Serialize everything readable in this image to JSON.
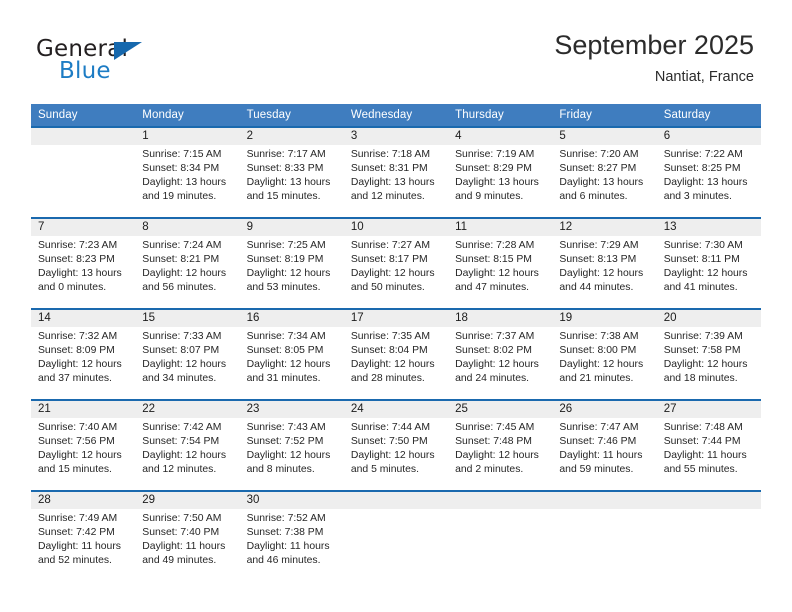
{
  "brand": {
    "word_one": "General",
    "word_two": "Blue",
    "logo_icon": "triangle-logo-icon",
    "accent_color": "#1d7cc4"
  },
  "header": {
    "title": "September 2025",
    "subtitle": "Nantiat, France"
  },
  "theme": {
    "header_row_color": "#3f7dbf",
    "week_divider_color": "#1a69ae",
    "daynum_band_color": "#eeeeee"
  },
  "calendar": {
    "day_headers": [
      "Sunday",
      "Monday",
      "Tuesday",
      "Wednesday",
      "Thursday",
      "Friday",
      "Saturday"
    ],
    "weeks": [
      [
        {
          "day": "",
          "empty": true
        },
        {
          "day": "1",
          "sunrise": "Sunrise: 7:15 AM",
          "sunset": "Sunset: 8:34 PM",
          "daylight_1": "Daylight: 13 hours",
          "daylight_2": "and 19 minutes."
        },
        {
          "day": "2",
          "sunrise": "Sunrise: 7:17 AM",
          "sunset": "Sunset: 8:33 PM",
          "daylight_1": "Daylight: 13 hours",
          "daylight_2": "and 15 minutes."
        },
        {
          "day": "3",
          "sunrise": "Sunrise: 7:18 AM",
          "sunset": "Sunset: 8:31 PM",
          "daylight_1": "Daylight: 13 hours",
          "daylight_2": "and 12 minutes."
        },
        {
          "day": "4",
          "sunrise": "Sunrise: 7:19 AM",
          "sunset": "Sunset: 8:29 PM",
          "daylight_1": "Daylight: 13 hours",
          "daylight_2": "and 9 minutes."
        },
        {
          "day": "5",
          "sunrise": "Sunrise: 7:20 AM",
          "sunset": "Sunset: 8:27 PM",
          "daylight_1": "Daylight: 13 hours",
          "daylight_2": "and 6 minutes."
        },
        {
          "day": "6",
          "sunrise": "Sunrise: 7:22 AM",
          "sunset": "Sunset: 8:25 PM",
          "daylight_1": "Daylight: 13 hours",
          "daylight_2": "and 3 minutes."
        }
      ],
      [
        {
          "day": "7",
          "sunrise": "Sunrise: 7:23 AM",
          "sunset": "Sunset: 8:23 PM",
          "daylight_1": "Daylight: 13 hours",
          "daylight_2": "and 0 minutes."
        },
        {
          "day": "8",
          "sunrise": "Sunrise: 7:24 AM",
          "sunset": "Sunset: 8:21 PM",
          "daylight_1": "Daylight: 12 hours",
          "daylight_2": "and 56 minutes."
        },
        {
          "day": "9",
          "sunrise": "Sunrise: 7:25 AM",
          "sunset": "Sunset: 8:19 PM",
          "daylight_1": "Daylight: 12 hours",
          "daylight_2": "and 53 minutes."
        },
        {
          "day": "10",
          "sunrise": "Sunrise: 7:27 AM",
          "sunset": "Sunset: 8:17 PM",
          "daylight_1": "Daylight: 12 hours",
          "daylight_2": "and 50 minutes."
        },
        {
          "day": "11",
          "sunrise": "Sunrise: 7:28 AM",
          "sunset": "Sunset: 8:15 PM",
          "daylight_1": "Daylight: 12 hours",
          "daylight_2": "and 47 minutes."
        },
        {
          "day": "12",
          "sunrise": "Sunrise: 7:29 AM",
          "sunset": "Sunset: 8:13 PM",
          "daylight_1": "Daylight: 12 hours",
          "daylight_2": "and 44 minutes."
        },
        {
          "day": "13",
          "sunrise": "Sunrise: 7:30 AM",
          "sunset": "Sunset: 8:11 PM",
          "daylight_1": "Daylight: 12 hours",
          "daylight_2": "and 41 minutes."
        }
      ],
      [
        {
          "day": "14",
          "sunrise": "Sunrise: 7:32 AM",
          "sunset": "Sunset: 8:09 PM",
          "daylight_1": "Daylight: 12 hours",
          "daylight_2": "and 37 minutes."
        },
        {
          "day": "15",
          "sunrise": "Sunrise: 7:33 AM",
          "sunset": "Sunset: 8:07 PM",
          "daylight_1": "Daylight: 12 hours",
          "daylight_2": "and 34 minutes."
        },
        {
          "day": "16",
          "sunrise": "Sunrise: 7:34 AM",
          "sunset": "Sunset: 8:05 PM",
          "daylight_1": "Daylight: 12 hours",
          "daylight_2": "and 31 minutes."
        },
        {
          "day": "17",
          "sunrise": "Sunrise: 7:35 AM",
          "sunset": "Sunset: 8:04 PM",
          "daylight_1": "Daylight: 12 hours",
          "daylight_2": "and 28 minutes."
        },
        {
          "day": "18",
          "sunrise": "Sunrise: 7:37 AM",
          "sunset": "Sunset: 8:02 PM",
          "daylight_1": "Daylight: 12 hours",
          "daylight_2": "and 24 minutes."
        },
        {
          "day": "19",
          "sunrise": "Sunrise: 7:38 AM",
          "sunset": "Sunset: 8:00 PM",
          "daylight_1": "Daylight: 12 hours",
          "daylight_2": "and 21 minutes."
        },
        {
          "day": "20",
          "sunrise": "Sunrise: 7:39 AM",
          "sunset": "Sunset: 7:58 PM",
          "daylight_1": "Daylight: 12 hours",
          "daylight_2": "and 18 minutes."
        }
      ],
      [
        {
          "day": "21",
          "sunrise": "Sunrise: 7:40 AM",
          "sunset": "Sunset: 7:56 PM",
          "daylight_1": "Daylight: 12 hours",
          "daylight_2": "and 15 minutes."
        },
        {
          "day": "22",
          "sunrise": "Sunrise: 7:42 AM",
          "sunset": "Sunset: 7:54 PM",
          "daylight_1": "Daylight: 12 hours",
          "daylight_2": "and 12 minutes."
        },
        {
          "day": "23",
          "sunrise": "Sunrise: 7:43 AM",
          "sunset": "Sunset: 7:52 PM",
          "daylight_1": "Daylight: 12 hours",
          "daylight_2": "and 8 minutes."
        },
        {
          "day": "24",
          "sunrise": "Sunrise: 7:44 AM",
          "sunset": "Sunset: 7:50 PM",
          "daylight_1": "Daylight: 12 hours",
          "daylight_2": "and 5 minutes."
        },
        {
          "day": "25",
          "sunrise": "Sunrise: 7:45 AM",
          "sunset": "Sunset: 7:48 PM",
          "daylight_1": "Daylight: 12 hours",
          "daylight_2": "and 2 minutes."
        },
        {
          "day": "26",
          "sunrise": "Sunrise: 7:47 AM",
          "sunset": "Sunset: 7:46 PM",
          "daylight_1": "Daylight: 11 hours",
          "daylight_2": "and 59 minutes."
        },
        {
          "day": "27",
          "sunrise": "Sunrise: 7:48 AM",
          "sunset": "Sunset: 7:44 PM",
          "daylight_1": "Daylight: 11 hours",
          "daylight_2": "and 55 minutes."
        }
      ],
      [
        {
          "day": "28",
          "sunrise": "Sunrise: 7:49 AM",
          "sunset": "Sunset: 7:42 PM",
          "daylight_1": "Daylight: 11 hours",
          "daylight_2": "and 52 minutes."
        },
        {
          "day": "29",
          "sunrise": "Sunrise: 7:50 AM",
          "sunset": "Sunset: 7:40 PM",
          "daylight_1": "Daylight: 11 hours",
          "daylight_2": "and 49 minutes."
        },
        {
          "day": "30",
          "sunrise": "Sunrise: 7:52 AM",
          "sunset": "Sunset: 7:38 PM",
          "daylight_1": "Daylight: 11 hours",
          "daylight_2": "and 46 minutes."
        },
        {
          "day": "",
          "empty": true
        },
        {
          "day": "",
          "empty": true
        },
        {
          "day": "",
          "empty": true
        },
        {
          "day": "",
          "empty": true
        }
      ]
    ]
  }
}
